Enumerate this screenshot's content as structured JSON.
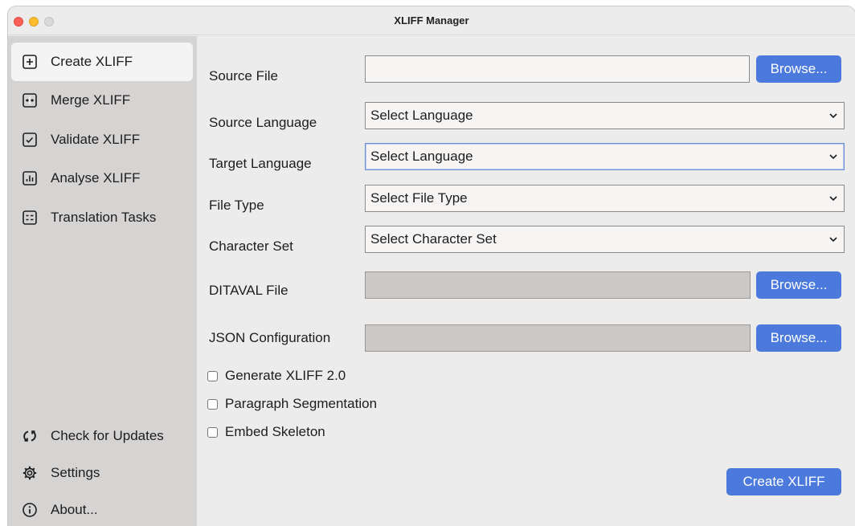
{
  "window": {
    "title": "XLIFF Manager"
  },
  "sidebar": {
    "items": [
      {
        "label": "Create XLIFF",
        "icon": "plus-square-icon",
        "active": true
      },
      {
        "label": "Merge XLIFF",
        "icon": "merge-icon",
        "active": false
      },
      {
        "label": "Validate XLIFF",
        "icon": "check-square-icon",
        "active": false
      },
      {
        "label": "Analyse XLIFF",
        "icon": "chart-square-icon",
        "active": false
      },
      {
        "label": "Translation Tasks",
        "icon": "list-square-icon",
        "active": false
      }
    ],
    "bottom_items": [
      {
        "label": "Check for Updates",
        "icon": "refresh-icon"
      },
      {
        "label": "Settings",
        "icon": "gear-icon"
      },
      {
        "label": "About...",
        "icon": "info-icon"
      }
    ]
  },
  "form": {
    "source_file": {
      "label": "Source File",
      "value": "",
      "browse_label": "Browse..."
    },
    "source_language": {
      "label": "Source Language",
      "selected": "Select Language"
    },
    "target_language": {
      "label": "Target Language",
      "selected": "Select Language"
    },
    "file_type": {
      "label": "File Type",
      "selected": "Select File Type"
    },
    "character_set": {
      "label": "Character Set",
      "selected": "Select Character Set"
    },
    "ditaval_file": {
      "label": "DITAVAL File",
      "value": "",
      "browse_label": "Browse..."
    },
    "json_configuration": {
      "label": "JSON Configuration",
      "value": "",
      "browse_label": "Browse..."
    },
    "checkboxes": [
      {
        "label": "Generate XLIFF 2.0",
        "checked": false
      },
      {
        "label": "Paragraph Segmentation",
        "checked": false
      },
      {
        "label": "Embed Skeleton",
        "checked": false
      }
    ],
    "submit_label": "Create XLIFF"
  },
  "colors": {
    "accent": "#4b79dc",
    "sidebar_bg": "#d6d4d2",
    "window_bg": "#ececec"
  }
}
